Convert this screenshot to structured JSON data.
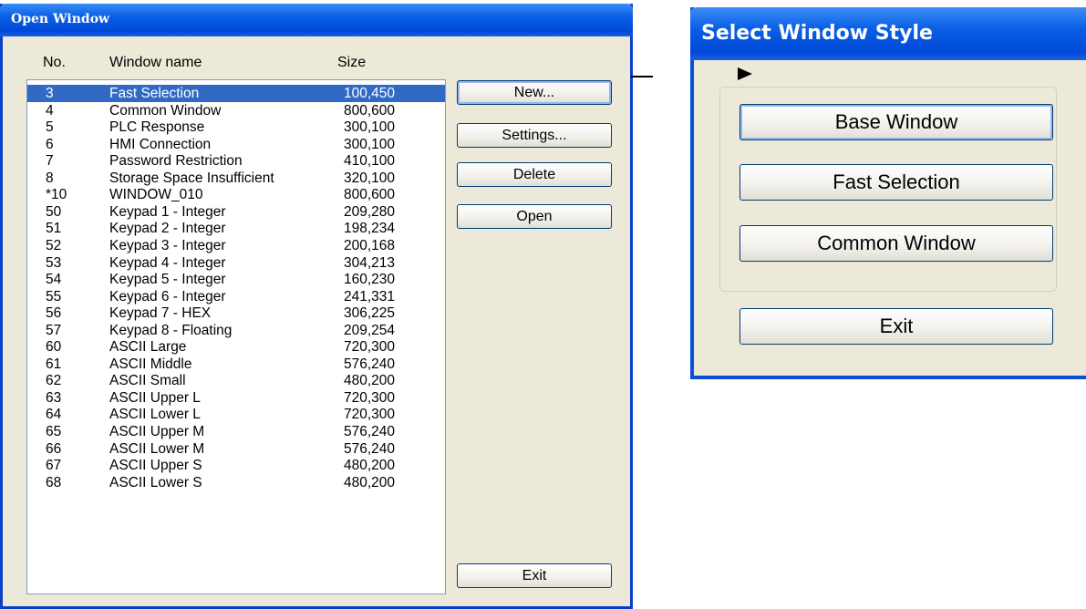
{
  "open_window": {
    "title": "Open Window",
    "columns": {
      "no": "No.",
      "name": "Window name",
      "size": "Size"
    },
    "rows": [
      {
        "no": "3",
        "name": "Fast Selection",
        "size": "100,450",
        "selected": true
      },
      {
        "no": "4",
        "name": "Common Window",
        "size": "800,600"
      },
      {
        "no": "5",
        "name": "PLC Response",
        "size": "300,100"
      },
      {
        "no": "6",
        "name": "HMI Connection",
        "size": "300,100"
      },
      {
        "no": "7",
        "name": "Password Restriction",
        "size": "410,100"
      },
      {
        "no": "8",
        "name": "Storage Space Insufficient",
        "size": "320,100"
      },
      {
        "no": "*10",
        "name": "WINDOW_010",
        "size": "800,600"
      },
      {
        "no": "50",
        "name": "Keypad 1 - Integer",
        "size": "209,280"
      },
      {
        "no": "51",
        "name": "Keypad 2 - Integer",
        "size": "198,234"
      },
      {
        "no": "52",
        "name": "Keypad 3 - Integer",
        "size": "200,168"
      },
      {
        "no": "53",
        "name": "Keypad 4 - Integer",
        "size": "304,213"
      },
      {
        "no": "54",
        "name": "Keypad 5 - Integer",
        "size": "160,230"
      },
      {
        "no": "55",
        "name": "Keypad 6 - Integer",
        "size": "241,331"
      },
      {
        "no": "56",
        "name": "Keypad 7 - HEX",
        "size": "306,225"
      },
      {
        "no": "57",
        "name": "Keypad 8 - Floating",
        "size": "209,254"
      },
      {
        "no": "60",
        "name": "ASCII Large",
        "size": "720,300"
      },
      {
        "no": "61",
        "name": "ASCII Middle",
        "size": "576,240"
      },
      {
        "no": "62",
        "name": "ASCII Small",
        "size": "480,200"
      },
      {
        "no": "63",
        "name": "ASCII Upper L",
        "size": "720,300"
      },
      {
        "no": "64",
        "name": "ASCII Lower L",
        "size": "720,300"
      },
      {
        "no": "65",
        "name": "ASCII Upper M",
        "size": "576,240"
      },
      {
        "no": "66",
        "name": "ASCII Lower M",
        "size": "576,240"
      },
      {
        "no": "67",
        "name": "ASCII Upper S",
        "size": "480,200"
      },
      {
        "no": "68",
        "name": "ASCII Lower S",
        "size": "480,200"
      }
    ],
    "buttons": {
      "new": "New...",
      "settings": "Settings...",
      "delete": "Delete",
      "open": "Open",
      "exit": "Exit"
    }
  },
  "select_window_style": {
    "title": "Select Window Style",
    "buttons": {
      "base": "Base Window",
      "fast": "Fast Selection",
      "common": "Common Window",
      "exit": "Exit"
    }
  },
  "colors": {
    "title_bar": "#0A5FE3",
    "selection": "#316AC5",
    "dialog_bg": "#ECE9D8"
  }
}
